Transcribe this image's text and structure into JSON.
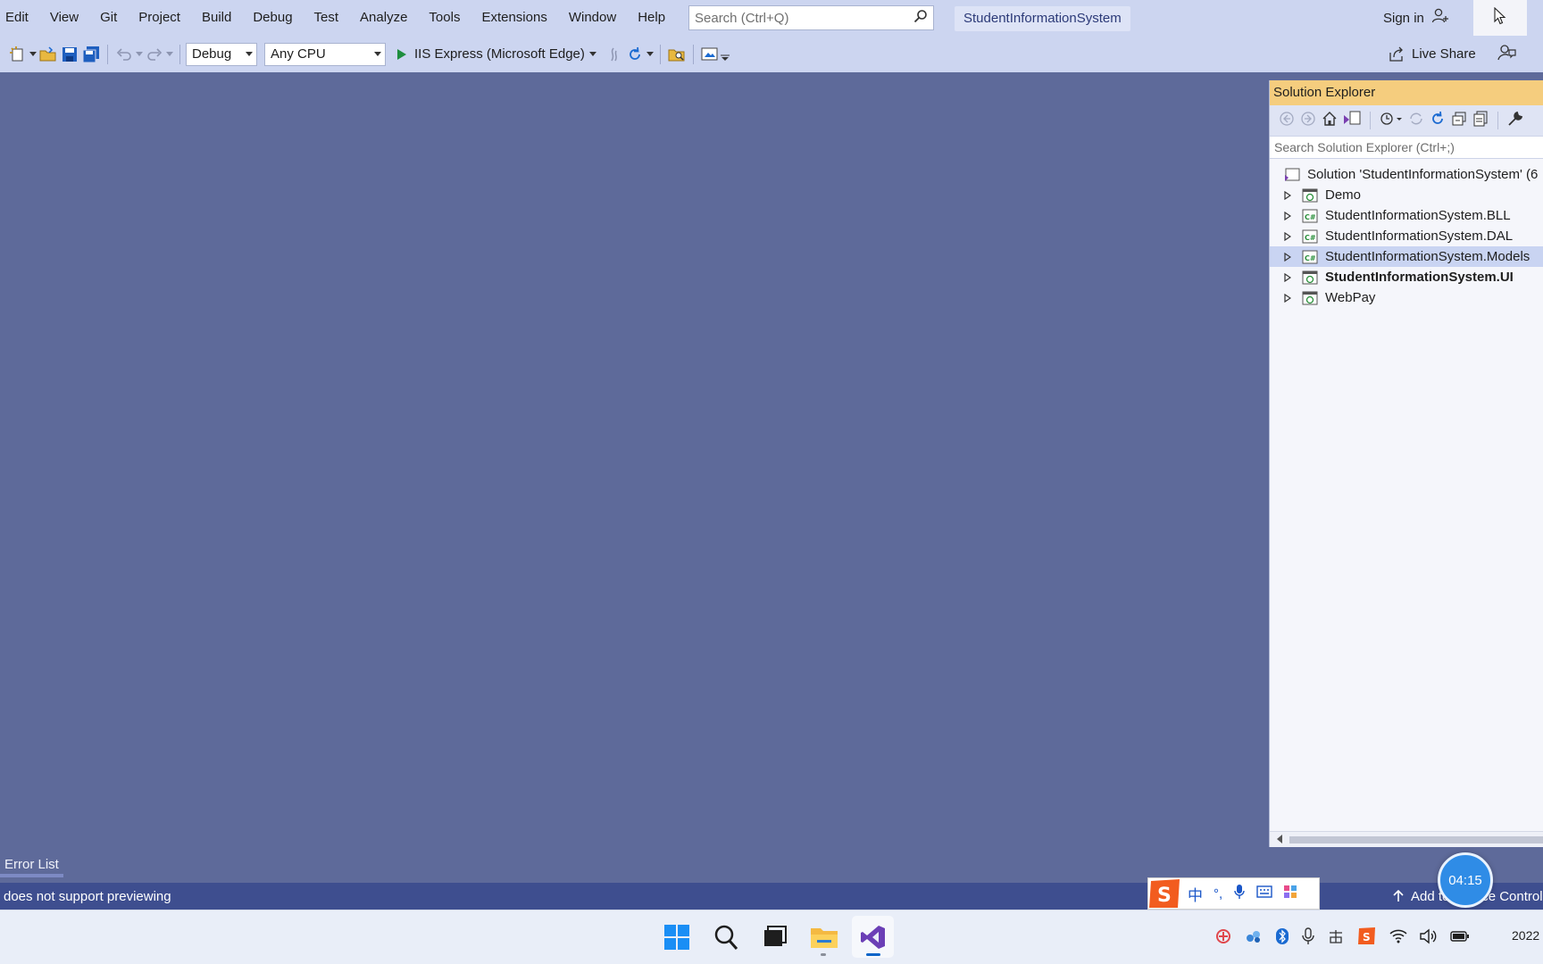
{
  "menu": {
    "items": [
      "Edit",
      "View",
      "Git",
      "Project",
      "Build",
      "Debug",
      "Test",
      "Analyze",
      "Tools",
      "Extensions",
      "Window",
      "Help"
    ],
    "search_placeholder": "Search (Ctrl+Q)",
    "solution_name": "StudentInformationSystem",
    "sign_in": "Sign in"
  },
  "toolbar": {
    "config": "Debug",
    "platform": "Any CPU",
    "run_target": "IIS Express (Microsoft Edge)",
    "live_share": "Live Share"
  },
  "solution_explorer": {
    "title": "Solution Explorer",
    "search_placeholder": "Search Solution Explorer (Ctrl+;)",
    "root": "Solution 'StudentInformationSystem' (6",
    "projects": [
      {
        "name": "Demo",
        "icon": "web-project-icon"
      },
      {
        "name": "StudentInformationSystem.BLL",
        "icon": "csharp-project-icon"
      },
      {
        "name": "StudentInformationSystem.DAL",
        "icon": "csharp-project-icon"
      },
      {
        "name": "StudentInformationSystem.Models",
        "icon": "csharp-project-icon",
        "selected": true
      },
      {
        "name": "StudentInformationSystem.UI",
        "icon": "web-project-icon",
        "startup": true
      },
      {
        "name": "WebPay",
        "icon": "web-project-icon"
      }
    ]
  },
  "bottom": {
    "error_list_tab": "Error List",
    "status_text": "does not support previewing",
    "status_right": "Add to Source Control",
    "ime_char": "中",
    "timer": "04:15"
  },
  "taskbar": {
    "date_partial": "2022"
  },
  "colors": {
    "background": "#5e6a9a",
    "chrome": "#ccd5f0",
    "statusbar": "#3e4e8f",
    "se_title": "#f5cd7e",
    "selection": "#c9d4f2"
  }
}
